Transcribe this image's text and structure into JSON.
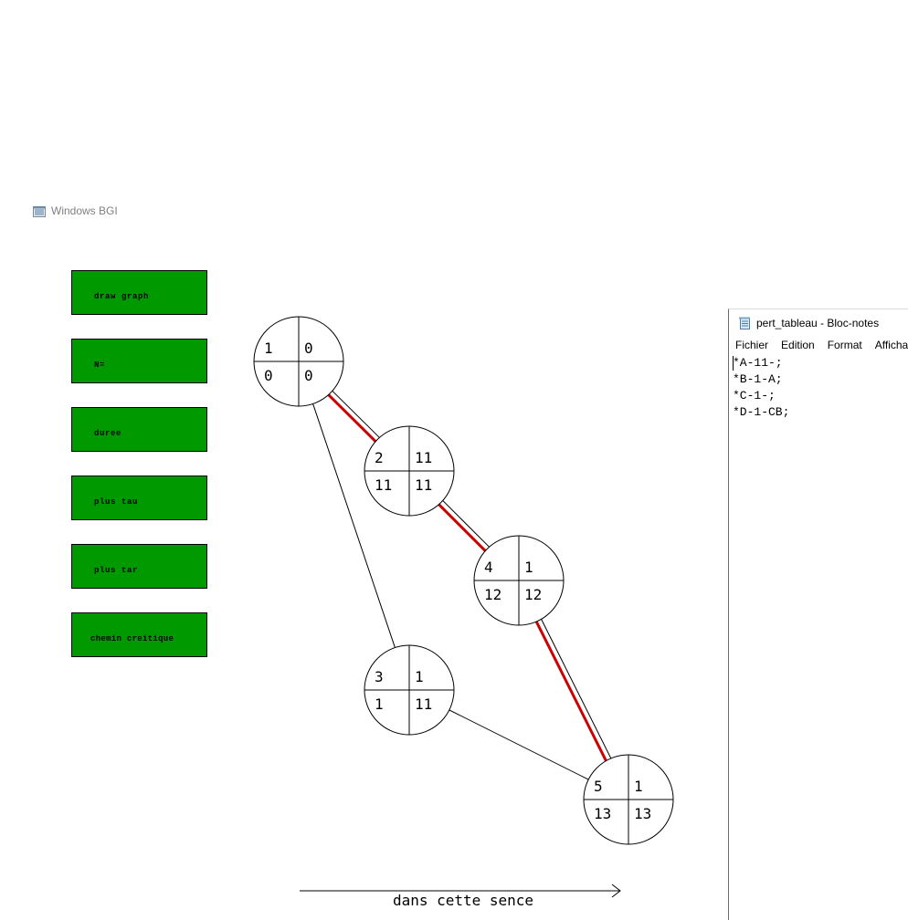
{
  "bgi_window": {
    "title": "Windows BGI",
    "icon": "window-app-icon"
  },
  "menu": {
    "buttons": [
      {
        "label": "draw graph"
      },
      {
        "label": "N="
      },
      {
        "label": "duree"
      },
      {
        "label": "plus tau"
      },
      {
        "label": "plus tar"
      },
      {
        "label": "chemin creitique"
      }
    ],
    "color": "#009900"
  },
  "graph": {
    "nodes": [
      {
        "id": "1",
        "duration": "0",
        "earliest": "0",
        "latest": "0"
      },
      {
        "id": "2",
        "duration": "11",
        "earliest": "11",
        "latest": "11"
      },
      {
        "id": "3",
        "duration": "1",
        "earliest": "1",
        "latest": "11"
      },
      {
        "id": "4",
        "duration": "1",
        "earliest": "12",
        "latest": "12"
      },
      {
        "id": "5",
        "duration": "1",
        "earliest": "13",
        "latest": "13"
      }
    ],
    "edges": [
      {
        "from": "1",
        "to": "2",
        "critical": true
      },
      {
        "from": "2",
        "to": "4",
        "critical": true
      },
      {
        "from": "4",
        "to": "5",
        "critical": true
      },
      {
        "from": "1",
        "to": "3",
        "critical": false
      },
      {
        "from": "3",
        "to": "5",
        "critical": false
      }
    ],
    "critical_color": "#cc0000",
    "direction_label": "dans cette sence"
  },
  "notepad": {
    "title": "pert_tableau - Bloc-notes",
    "icon": "notepad-icon",
    "menus": [
      "Fichier",
      "Edition",
      "Format",
      "Afficha"
    ],
    "lines": [
      "*A-11-;",
      "*B-1-A;",
      "*C-1-;",
      "*D-1-CB;"
    ]
  }
}
